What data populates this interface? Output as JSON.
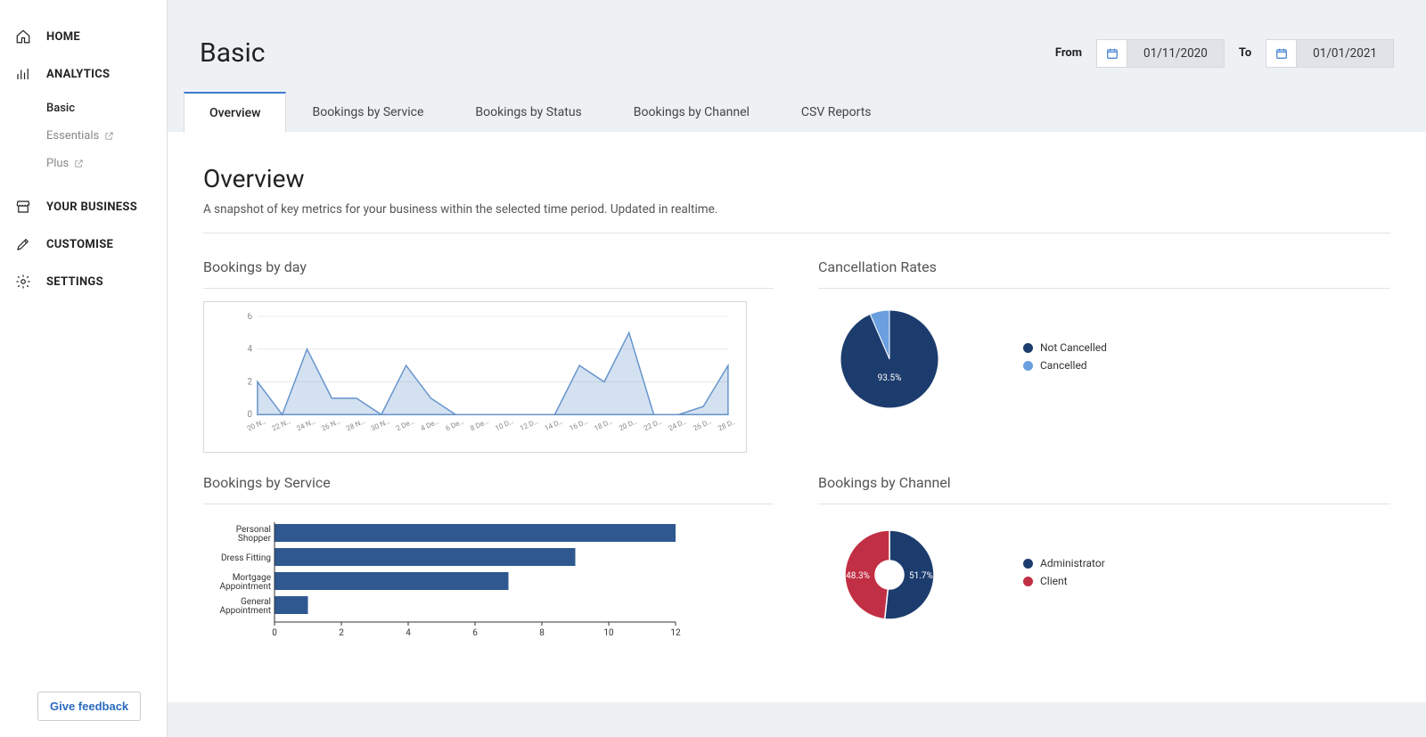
{
  "sidebar": {
    "items": [
      {
        "label": "HOME"
      },
      {
        "label": "ANALYTICS"
      },
      {
        "label": "YOUR BUSINESS"
      },
      {
        "label": "CUSTOMISE"
      },
      {
        "label": "SETTINGS"
      }
    ],
    "analytics_sub": [
      {
        "label": "Basic",
        "active": true
      },
      {
        "label": "Essentials",
        "external": true
      },
      {
        "label": "Plus",
        "external": true
      }
    ],
    "feedback_label": "Give feedback"
  },
  "header": {
    "title": "Basic",
    "from_label": "From",
    "to_label": "To",
    "from_value": "01/11/2020",
    "to_value": "01/01/2021"
  },
  "tabs": [
    {
      "label": "Overview"
    },
    {
      "label": "Bookings by Service"
    },
    {
      "label": "Bookings by Status"
    },
    {
      "label": "Bookings by Channel"
    },
    {
      "label": "CSV Reports"
    }
  ],
  "overview": {
    "title": "Overview",
    "desc": "A snapshot of key metrics for your business within the selected time period. Updated in realtime."
  },
  "chart_data": [
    {
      "id": "bookings_day",
      "type": "area",
      "title": "Bookings by day",
      "xlabel": "",
      "ylabel": "",
      "ylim": [
        0,
        6
      ],
      "yticks": [
        0,
        2,
        4,
        6
      ],
      "categories": [
        "20 N…",
        "22 N…",
        "24 N…",
        "26 N…",
        "28 N…",
        "30 N…",
        "2 De…",
        "4 De…",
        "6 De…",
        "8 De…",
        "10 D…",
        "12 D…",
        "14 D…",
        "16 D…",
        "18 D…",
        "20 D…",
        "22 D…",
        "24 D…",
        "26 D…",
        "28 D…"
      ],
      "values": [
        2,
        0,
        4,
        1,
        1,
        0,
        3,
        1,
        0,
        0,
        0,
        0,
        0,
        3,
        2,
        5,
        0,
        0,
        0.5,
        3
      ]
    },
    {
      "id": "cancellation_rates",
      "type": "pie",
      "title": "Cancellation Rates",
      "series": [
        {
          "name": "Not Cancelled",
          "value": 93.5,
          "color": "#1d3c6e"
        },
        {
          "name": "Cancelled",
          "value": 6.5,
          "color": "#6aa0df"
        }
      ],
      "labels_shown": [
        "93.5%"
      ]
    },
    {
      "id": "bookings_service",
      "type": "bar",
      "orientation": "horizontal",
      "title": "Bookings by Service",
      "xlim": [
        0,
        12
      ],
      "xticks": [
        0,
        2,
        4,
        6,
        8,
        10,
        12
      ],
      "categories": [
        "Personal Shopper",
        "Dress Fitting",
        "Mortgage Appointment",
        "General Appointment"
      ],
      "values": [
        12,
        9,
        7,
        1
      ]
    },
    {
      "id": "bookings_channel",
      "type": "pie",
      "donut": true,
      "title": "Bookings by Channel",
      "series": [
        {
          "name": "Administrator",
          "value": 51.7,
          "color": "#1d3c6e"
        },
        {
          "name": "Client",
          "value": 48.3,
          "color": "#c12f44"
        }
      ],
      "labels_shown": [
        "51.7%",
        "48.3%"
      ]
    }
  ],
  "colors": {
    "accent": "#3a7ccf",
    "navy": "#1d3c6e",
    "bar": "#2e588f",
    "red": "#c12f44",
    "light_blue": "#6aa0df"
  }
}
